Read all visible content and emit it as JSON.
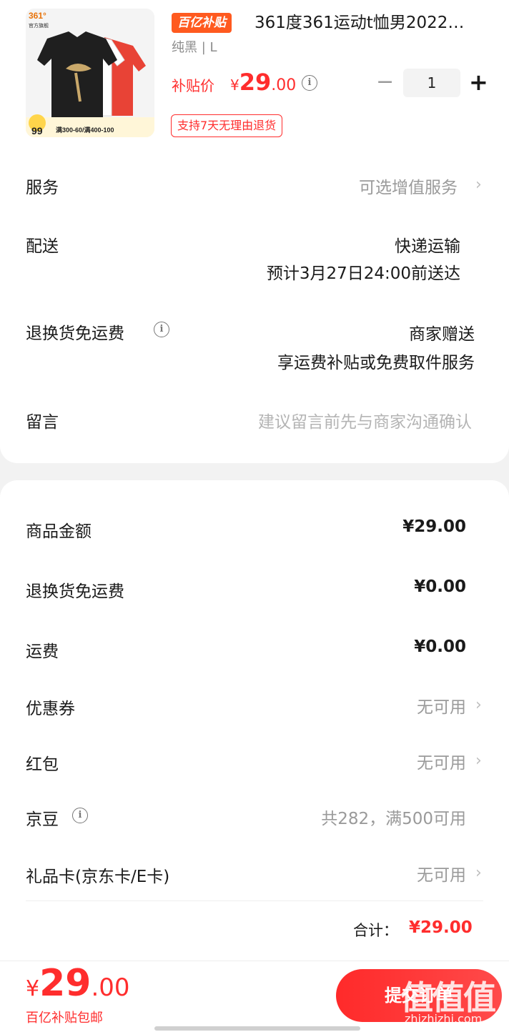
{
  "product": {
    "badge": "百亿补贴",
    "title": "361度361运动t恤男2022…",
    "spec": "纯黑 | L",
    "price_label": "补贴价",
    "price_currency": "¥",
    "price_int": "29",
    "price_dec": ".00",
    "quantity": "1",
    "return_tag": "支持7天无理由退货",
    "thumb": {
      "brand": "361°",
      "store": "官方旗舰",
      "promo_price": "99",
      "promo_text": "满300-60/满400-100"
    }
  },
  "service": {
    "label": "服务",
    "value": "可选增值服务"
  },
  "delivery": {
    "label": "配送",
    "method": "快递运输",
    "eta": "预计3月27日24:00前送达"
  },
  "return_shipping": {
    "label": "退换货免运费",
    "value": "商家赠送",
    "desc": "享运费补贴或免费取件服务"
  },
  "message": {
    "label": "留言",
    "placeholder": "建议留言前先与商家沟通确认"
  },
  "summary": {
    "goods_label": "商品金额",
    "goods_value": "¥29.00",
    "return_label": "退换货免运费",
    "return_value": "¥0.00",
    "shipping_label": "运费",
    "shipping_value": "¥0.00",
    "coupon_label": "优惠券",
    "coupon_value": "无可用",
    "redpacket_label": "红包",
    "redpacket_value": "无可用",
    "jingdou_label": "京豆",
    "jingdou_value": "共282，满500可用",
    "giftcard_label": "礼品卡(京东卡/E卡)",
    "giftcard_value": "无可用",
    "total_label": "合计：",
    "total_value": "¥29.00"
  },
  "bottom": {
    "currency": "¥",
    "price_int": "29",
    "price_dec": ".00",
    "sub": "百亿补贴包邮",
    "submit": "提交订单",
    "watermark": "值值值",
    "watermark_url": "zhizhizhi.com"
  },
  "colors": {
    "accent": "#ff2d2d",
    "badge": "#ff5a1f"
  },
  "icons": [
    "info-icon",
    "chevron-right-icon",
    "minus-icon",
    "plus-icon"
  ]
}
